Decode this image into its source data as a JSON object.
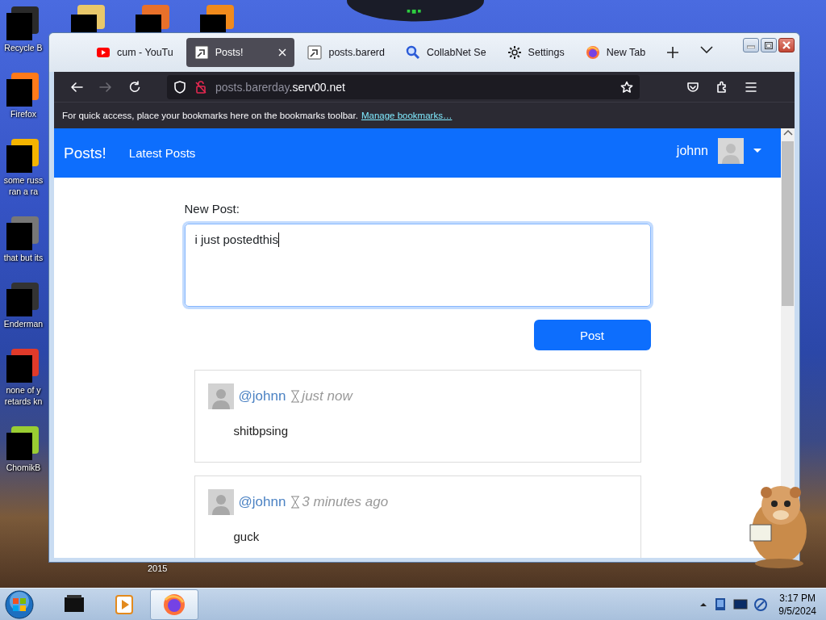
{
  "desktop": {
    "icons": [
      {
        "label": "Recycle B"
      },
      {
        "label": "Firefox"
      },
      {
        "label": "some russ\nran a ra"
      },
      {
        "label": "that but its"
      },
      {
        "label": "Enderman"
      },
      {
        "label": "none of y\nretards kn"
      },
      {
        "label": "ChomikB"
      }
    ],
    "hidden_icon_label": "2015"
  },
  "browser": {
    "tabs": [
      {
        "title": "cum - YouTu",
        "selected": false
      },
      {
        "title": "Posts!",
        "selected": true
      },
      {
        "title": "posts.barerd",
        "selected": false
      },
      {
        "title": "CollabNet Se",
        "selected": false
      },
      {
        "title": "Settings",
        "selected": false
      },
      {
        "title": "New Tab",
        "selected": false
      }
    ],
    "forward_disabled": true,
    "url": {
      "dimmed": "posts.barerday",
      "main": ".serv00.net"
    },
    "bookmarks_bar": {
      "message": "For quick access, place your bookmarks here on the bookmarks toolbar.",
      "link": "Manage bookmarks…"
    }
  },
  "page": {
    "navbar": {
      "brand": "Posts!",
      "links": [
        "Latest Posts"
      ],
      "user": "johnn"
    },
    "new_post": {
      "label": "New Post:",
      "value": "i just postedthis",
      "button": "Post"
    },
    "posts": [
      {
        "user": "@johnn",
        "time": "just now",
        "body": "shitbpsing"
      },
      {
        "user": "@johnn",
        "time": "3 minutes ago",
        "body": "guck"
      }
    ]
  },
  "taskbar": {
    "apps": [
      {
        "selected": false
      },
      {
        "selected": false
      },
      {
        "selected": true
      }
    ],
    "clock": {
      "time": "3:17 PM",
      "date": "9/5/2024"
    }
  }
}
